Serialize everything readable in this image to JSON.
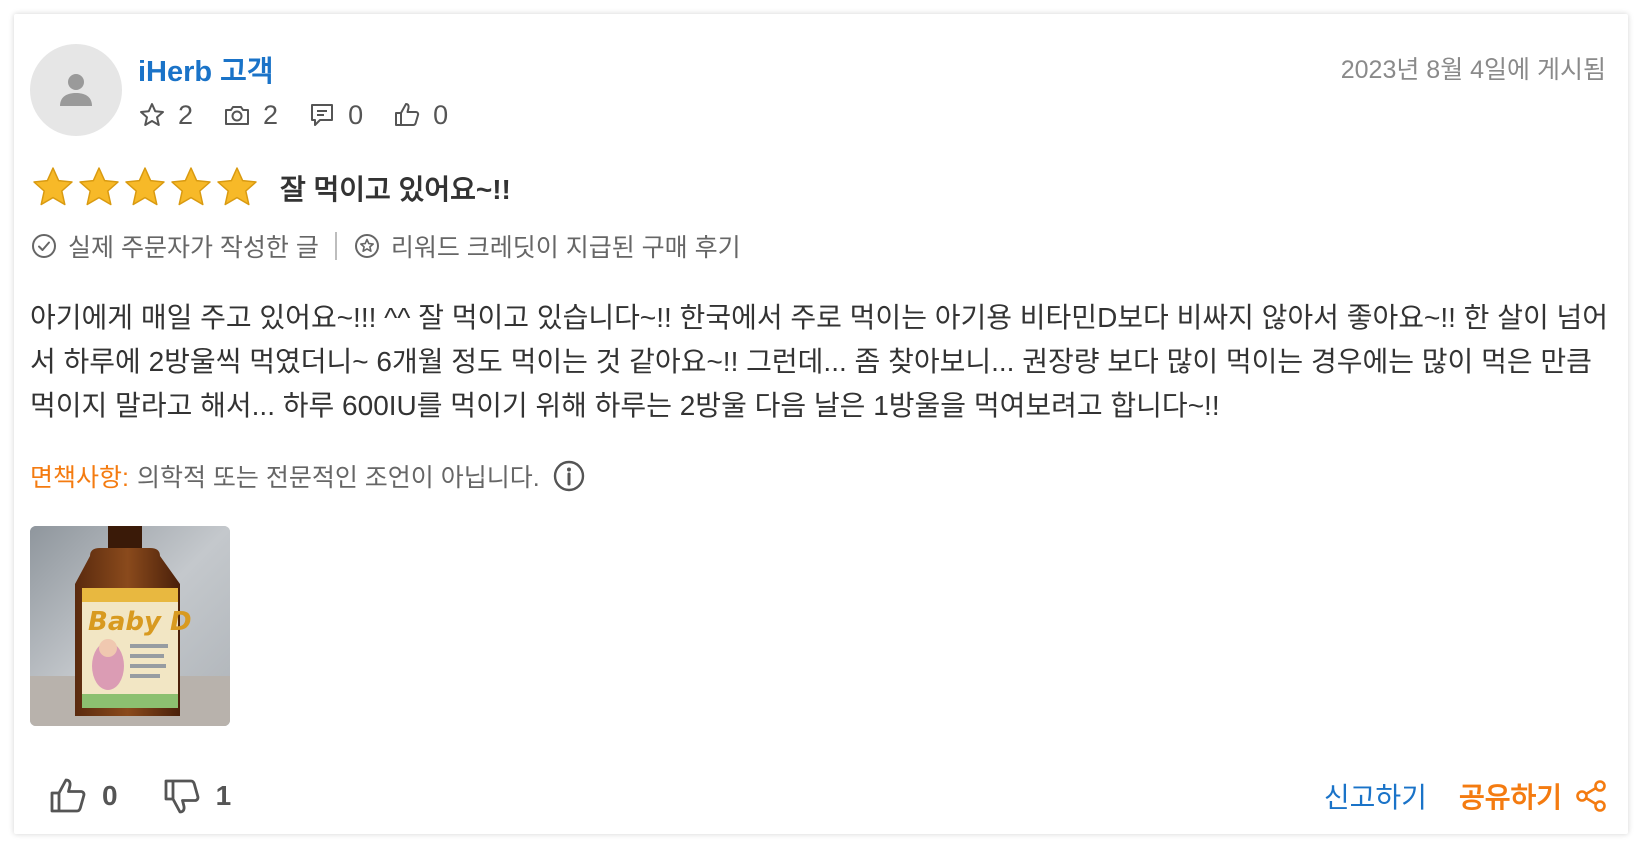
{
  "review": {
    "author": "iHerb 고객",
    "date": "2023년 8월 4일에 게시됨",
    "stats": {
      "stars": "2",
      "photos": "2",
      "comments": "0",
      "likes": "0"
    },
    "rating": 5,
    "rating_max": 5,
    "title": "잘 먹이고 있어요~!!",
    "badges": {
      "verified": "실제 주문자가 작성한 글",
      "rewarded": "리워드 크레딧이 지급된 구매 후기"
    },
    "body": "아기에게 매일 주고 있어요~!!! ^^ 잘 먹이고 있습니다~!! 한국에서 주로 먹이는 아기용 비타민D보다 비싸지 않아서 좋아요~!! 한 살이 넘어서 하루에 2방울씩 먹였더니~ 6개월 정도 먹이는 것 같아요~!! 그런데... 좀 찾아보니... 권장량 보다 많이 먹이는 경우에는 많이 먹은 만큼 먹이지 말라고 해서... 하루 600IU를 먹이기 위해 하루는 2방울 다음 날은 1방울을 먹여보려고 합니다~!!",
    "disclaimer": {
      "label": "면책사항:",
      "text": "의학적 또는 전문적인 조언이 아닙니다."
    },
    "photo": {
      "label_text": "Baby D"
    },
    "footer": {
      "helpful_count": "0",
      "unhelpful_count": "1",
      "report_label": "신고하기",
      "share_label": "공유하기"
    }
  },
  "colors": {
    "link_blue": "#1a73c8",
    "accent_orange": "#f47b10",
    "star_gold": "#f7b928",
    "muted_text": "#8a8a8a"
  },
  "icons": [
    "user-avatar-icon",
    "star-outline-icon",
    "camera-icon",
    "comment-icon",
    "thumbs-up-icon",
    "check-circle-icon",
    "reward-star-icon",
    "info-icon",
    "thumbs-down-icon",
    "share-icon"
  ]
}
